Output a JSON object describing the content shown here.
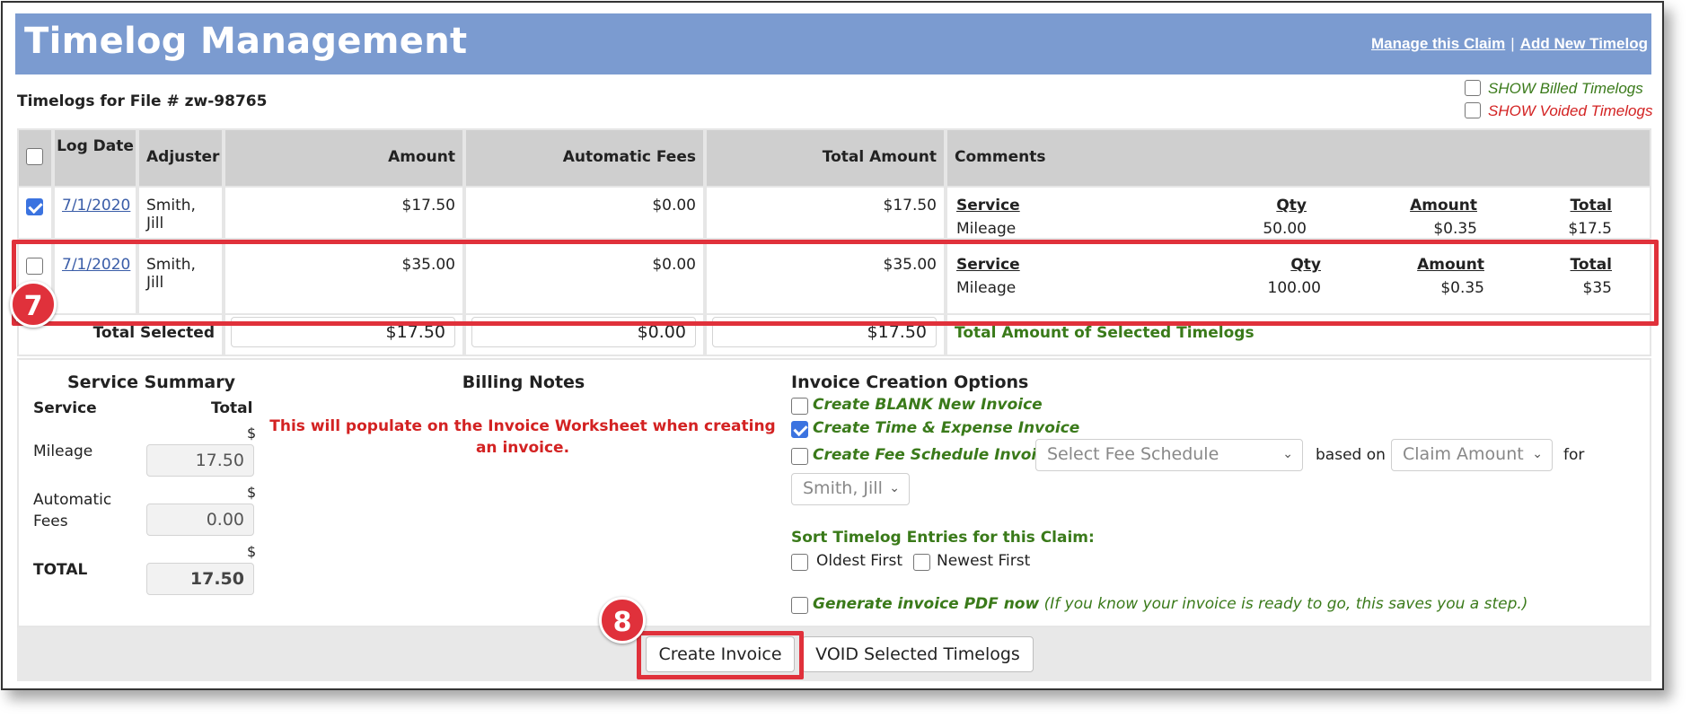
{
  "header": {
    "title": "Timelog Management",
    "links": {
      "manage": "Manage this Claim",
      "separator": "|",
      "add": "Add New Timelog"
    }
  },
  "file_label": "Timelogs for File # zw-98765",
  "show_options": {
    "billed": "SHOW Billed Timelogs",
    "voided": "SHOW Voided Timelogs"
  },
  "table": {
    "headers": {
      "log_date": "Log Date",
      "adjuster": "Adjuster",
      "amount": "Amount",
      "auto_fees": "Automatic Fees",
      "total_amount": "Total Amount",
      "comments": "Comments"
    },
    "comment_headers": {
      "service": "Service",
      "qty": "Qty",
      "amount": "Amount",
      "total": "Total"
    },
    "rows": [
      {
        "checked": true,
        "date": "7/1/2020",
        "adjuster": "Smith, Jill",
        "amount": "$17.50",
        "auto_fees": "$0.00",
        "total": "$17.50",
        "service": "Mileage",
        "qty": "50.00",
        "rate": "$0.35",
        "line_total": "$17.5"
      },
      {
        "checked": false,
        "date": "7/1/2020",
        "adjuster": "Smith, Jill",
        "amount": "$35.00",
        "auto_fees": "$0.00",
        "total": "$35.00",
        "service": "Mileage",
        "qty": "100.00",
        "rate": "$0.35",
        "line_total": "$35"
      }
    ],
    "totals": {
      "label": "Total Selected",
      "amount": "$17.50",
      "auto_fees": "$0.00",
      "total": "$17.50",
      "note": "Total Amount of Selected Timelogs"
    }
  },
  "service_summary": {
    "title": "Service Summary",
    "col_service": "Service",
    "col_total": "Total",
    "currency": "$",
    "items": [
      {
        "label": "Mileage",
        "value": "17.50"
      },
      {
        "label": "Automatic Fees",
        "value": "0.00"
      },
      {
        "label": "TOTAL",
        "value": "17.50"
      }
    ]
  },
  "billing_notes": {
    "title": "Billing Notes",
    "text": "This will populate on the Invoice Worksheet when creating an invoice."
  },
  "invoice_options": {
    "title": "Invoice Creation Options",
    "blank": "Create BLANK New Invoice",
    "time_expense": "Create Time & Expense Invoice",
    "fee_schedule": "Create Fee Schedule Invoice",
    "fee_schedule_select": "Select Fee Schedule",
    "based_on": "based on",
    "basis_select": "Claim Amount",
    "for": "for",
    "adjuster_select": "Smith, Jill",
    "sort_title": "Sort Timelog Entries for this Claim:",
    "oldest": "Oldest First",
    "newest": "Newest First",
    "generate_pdf": "Generate invoice PDF now",
    "generate_pdf_note": "(If you know your invoice is ready to go, this saves you a step.)"
  },
  "buttons": {
    "create": "Create Invoice",
    "void": "VOID Selected Timelogs"
  },
  "annotations": {
    "step7": "7",
    "step8": "8",
    "callout_color": "#e0313b"
  },
  "colors": {
    "title_bar": "#7b9bd0",
    "header_gray": "#cfcfcf",
    "green": "#3a7a1a",
    "red": "#d32222",
    "link": "#3a5da8"
  }
}
